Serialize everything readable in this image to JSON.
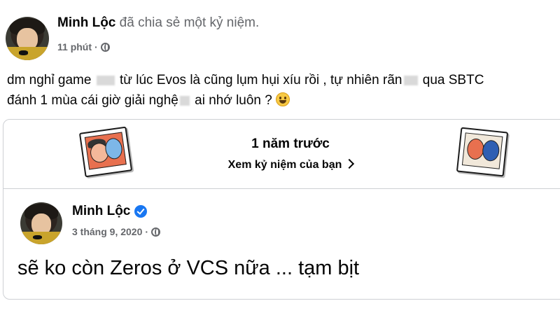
{
  "post": {
    "author": "Minh Lộc",
    "action": "đã chia sẻ một kỷ niệm.",
    "time": "11 phút",
    "separator": "·",
    "text_line1_part1": "dm nghỉ game",
    "text_line1_part2": "từ lúc Evos là cũng lụm hụi xíu rồi , tự nhiên rãn",
    "text_line1_part3": "qua SBTC",
    "text_line2_part1": "đánh 1 mùa cái giờ giải nghệ",
    "text_line2_part2": "ai nhớ luôn ?"
  },
  "memory": {
    "title": "1 năm trước",
    "link": "Xem kỷ niệm của bạn"
  },
  "original_post": {
    "author": "Minh Lộc",
    "date": "3 tháng 9, 2020",
    "separator": "·",
    "text": "sẽ ko còn Zeros ở VCS nữa ... tạm bịt"
  },
  "colors": {
    "verified": "#1877f2",
    "meta_text": "#65676b",
    "border": "#ced0d4"
  },
  "icons": [
    "globe-icon",
    "verified-badge-icon",
    "smile-emoji-icon",
    "chevron-right-icon",
    "memory-photo-icon"
  ]
}
